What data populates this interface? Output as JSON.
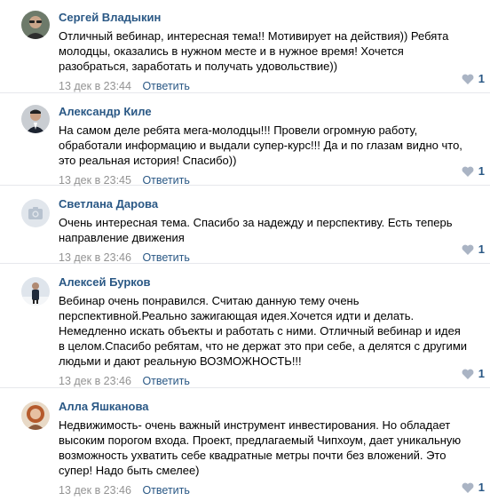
{
  "comments": [
    {
      "author": "Сергей Владыкин",
      "lines": [
        "Отличный вебинар, интересная тема!! Мотивирует на действия)) Ребята",
        "молодцы, оказались в нужном месте и в нужное время! Хочется",
        "разобраться, заработать и получать удовольствие))"
      ],
      "date": "13 дек в 23:44",
      "reply": "Ответить",
      "likes": "1",
      "avatar": "photo-person-glasses"
    },
    {
      "author": "Александр Киле",
      "lines": [
        "На самом деле ребята мега-молодцы!!! Провели огромную работу,",
        "обработали информацию и выдали супер-курс!!! Да и по глазам видно что,",
        "это реальная история! Спасибо))"
      ],
      "date": "13 дек в 23:45",
      "reply": "Ответить",
      "likes": "1",
      "avatar": "photo-person-suit"
    },
    {
      "author": "Светлана Дарова",
      "lines": [
        "Очень интересная тема. Спасибо за надежду и перспективу. Есть теперь",
        "направление движения"
      ],
      "date": "13 дек в 23:46",
      "reply": "Ответить",
      "likes": "1",
      "avatar": "camera-placeholder-icon"
    },
    {
      "author": "Алексей Бурков",
      "lines": [
        "Вебинар очень понравился. Считаю данную тему очень",
        "перспективной.Реально зажигающая идея.Хочется идти и делать.",
        "Немедленно искать объекты и работать с ними. Отличный вебинар и идея",
        "в целом.Спасибо ребятам, что не держат это при себе, а делятся с другими",
        "людьми и дают реальную ВОЗМОЖНОСТЬ!!!"
      ],
      "date": "13 дек в 23:46",
      "reply": "Ответить",
      "likes": "1",
      "avatar": "photo-person-winter"
    },
    {
      "author": "Алла Яшканова",
      "lines": [
        "Недвижимость- очень важный инструмент инвестирования. Но обладает",
        "высоким порогом входа. Проект, предлагаемый Чипхоум, дает уникальную",
        "возможность ухватить себе квадратные метры почти без вложений. Это",
        "супер! Надо быть смелее)"
      ],
      "date": "13 дек в 23:46",
      "reply": "Ответить",
      "likes": "1",
      "avatar": "photo-person-woman"
    }
  ],
  "colors": {
    "link": "#2a5885",
    "meta": "#939393",
    "divider": "#e7e8ec",
    "heart": "#aab4c4"
  }
}
